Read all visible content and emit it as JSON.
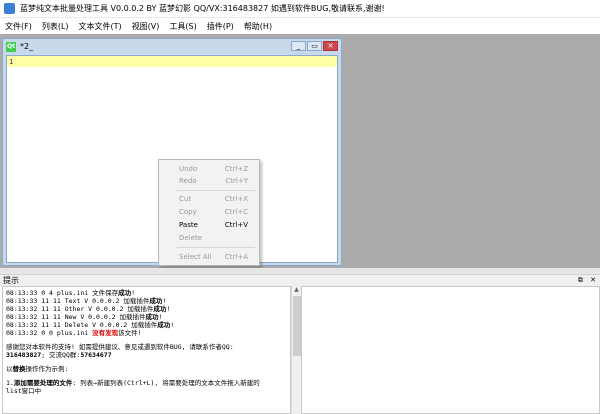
{
  "window": {
    "title": "蓝梦纯文本批量处理工具 V0.0.0.2 BY 蓝梦幻影 QQ/VX:316483827 如遇到软件BUG,敬请联系,谢谢!"
  },
  "menu": [
    "文件(F)",
    "列表(L)",
    "文本文件(T)",
    "视图(V)",
    "工具(S)",
    "插件(P)",
    "帮助(H)"
  ],
  "subwindow": {
    "icon": "Qt",
    "name": "*2_",
    "buttons": [
      "_",
      "▭",
      "✕"
    ],
    "line_number": "1"
  },
  "context_menu": {
    "items": [
      {
        "label": "Undo",
        "shortcut": "Ctrl+Z",
        "enabled": false
      },
      {
        "label": "Redo",
        "shortcut": "Ctrl+Y",
        "enabled": false
      },
      {
        "label": "Cut",
        "shortcut": "Ctrl+X",
        "enabled": false
      },
      {
        "label": "Copy",
        "shortcut": "Ctrl+C",
        "enabled": false
      },
      {
        "label": "Paste",
        "shortcut": "Ctrl+V",
        "enabled": true
      },
      {
        "label": "Delete",
        "shortcut": "",
        "enabled": false
      },
      {
        "label": "Select All",
        "shortcut": "Ctrl+A",
        "enabled": false
      }
    ]
  },
  "panel": {
    "title": "提示",
    "buttons": [
      "⧉",
      "✕"
    ]
  },
  "log": {
    "lines": [
      {
        "prefix": "08:13:33  0 4   plus.ini 文件保存",
        "highlight": "成功",
        "suffix": "!"
      },
      {
        "prefix": "08:13:33  11 11   Text V 0.0.0.2 加载插件",
        "highlight": "成功",
        "suffix": "!"
      },
      {
        "prefix": "08:13:32  11 11   Other V 0.0.0.2 加载插件",
        "highlight": "成功",
        "suffix": "!"
      },
      {
        "prefix": "08:13:32  11 11   New V 0.0.0.2 加载插件",
        "highlight": "成功",
        "suffix": "!"
      },
      {
        "prefix": "08:13:32  11 11   Delete V 0.0.0.2 加载插件",
        "highlight": "成功",
        "suffix": "!"
      },
      {
        "prefix": "08:13:32  0 0   plus.ini ",
        "highlight": "没有发现",
        "suffix": "该文件!"
      }
    ],
    "thanks_line": "感谢您对本软件的支持! 如需提供建议、意见或遇到软件BUG, 请联系作者QQ:",
    "contact_qq": "316483827",
    "contact_group_prefix": "; 交流QQ群:",
    "contact_group": "57634677",
    "example_prefix": "以",
    "example_bold": "替换",
    "example_suffix": "操作作为示例:",
    "step1_prefix": "1.",
    "step1_bold": "添加需要处理的文件",
    "step1_rest": ": 列表→新建列表(Ctrl+L), 将需要处理的文本文件拖入新建的",
    "step1_cont": "list窗口中"
  }
}
